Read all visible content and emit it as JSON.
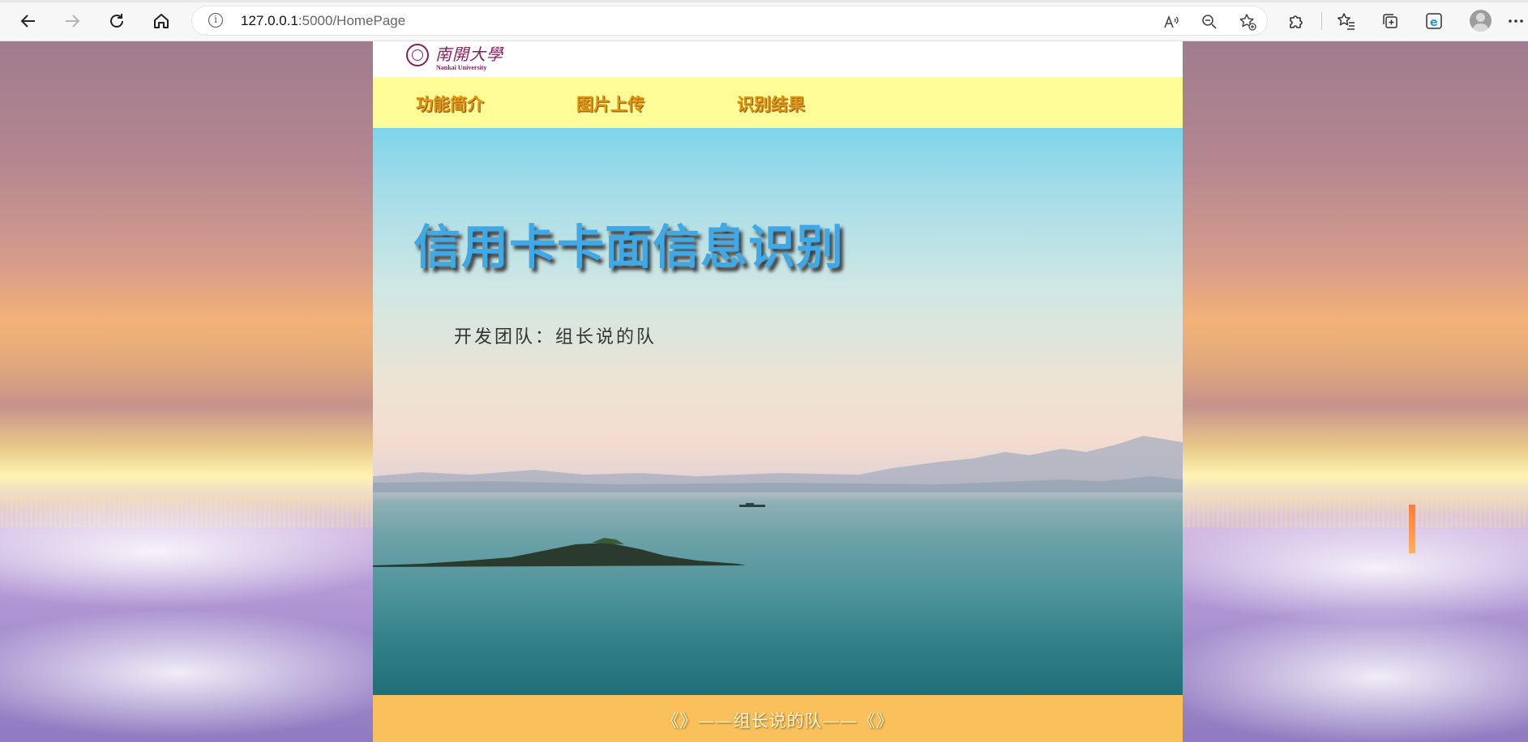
{
  "browser": {
    "url_host": "127.0.0.1",
    "url_path": ":5000/HomePage",
    "icons": {
      "back": "back-arrow-icon",
      "forward": "forward-arrow-icon",
      "refresh": "refresh-icon",
      "home": "home-icon",
      "site_info": "info-icon",
      "read_aloud": "read-aloud-icon",
      "zoom": "zoom-out-icon",
      "favorite": "add-favorite-icon",
      "extensions": "puzzle-icon",
      "favorites": "favorites-icon",
      "collections": "collections-icon",
      "ie_mode": "ie-mode-icon",
      "profile": "avatar-icon",
      "more": "more-icon"
    }
  },
  "site": {
    "logo": {
      "cn": "南開大學",
      "en": "Nankai University"
    },
    "nav": [
      {
        "label": "功能简介"
      },
      {
        "label": "图片上传"
      },
      {
        "label": "识别结果"
      }
    ],
    "hero": {
      "title": "信用卡卡面信息识别",
      "subtitle": "开发团队：组长说的队"
    },
    "footer": {
      "text": "《》——组长说的队——《》"
    },
    "colors": {
      "nav_bg": "#fffd98",
      "nav_text": "#e8940e",
      "title": "#3fa8e6",
      "footer_bg": "#fac05c"
    }
  }
}
